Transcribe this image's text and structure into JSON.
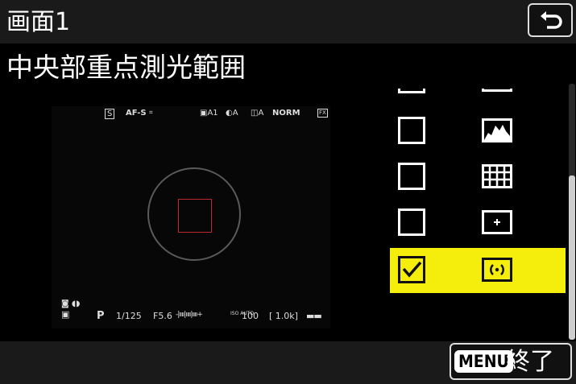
{
  "header": {
    "title": "画面1"
  },
  "option_title": "中央部重点測光範囲",
  "viewfinder": {
    "top": {
      "release_mode": "S",
      "focus_mode": "AF-S",
      "af_area": "⌗",
      "picture_control": "A1",
      "white_balance": "A",
      "active_dlighting": "A",
      "image_quality": "NORM",
      "image_area": "FX"
    },
    "bottom": {
      "exposure_mode": "P",
      "shutter": "1/125",
      "aperture": "F5.6",
      "iso_prefix": "ISO AUTO",
      "iso": "100",
      "remaining": "[ 1.0k]"
    }
  },
  "list": {
    "items": [
      {
        "name": "partial-row",
        "checked": false,
        "icon": "blank-icon"
      },
      {
        "name": "histogram-row",
        "checked": false,
        "icon": "histogram-icon"
      },
      {
        "name": "grid-row",
        "checked": false,
        "icon": "grid-icon"
      },
      {
        "name": "crosshair-row",
        "checked": false,
        "icon": "crosshair-icon"
      },
      {
        "name": "center-weighted-row",
        "checked": true,
        "icon": "center-weighted-metering-icon"
      }
    ]
  },
  "footer": {
    "menu_key": "MENU",
    "menu_label": "終了"
  },
  "colors": {
    "accent": "#f5ed0c",
    "metering_square": "#c0282d",
    "header_bg": "#1a1a1a"
  }
}
